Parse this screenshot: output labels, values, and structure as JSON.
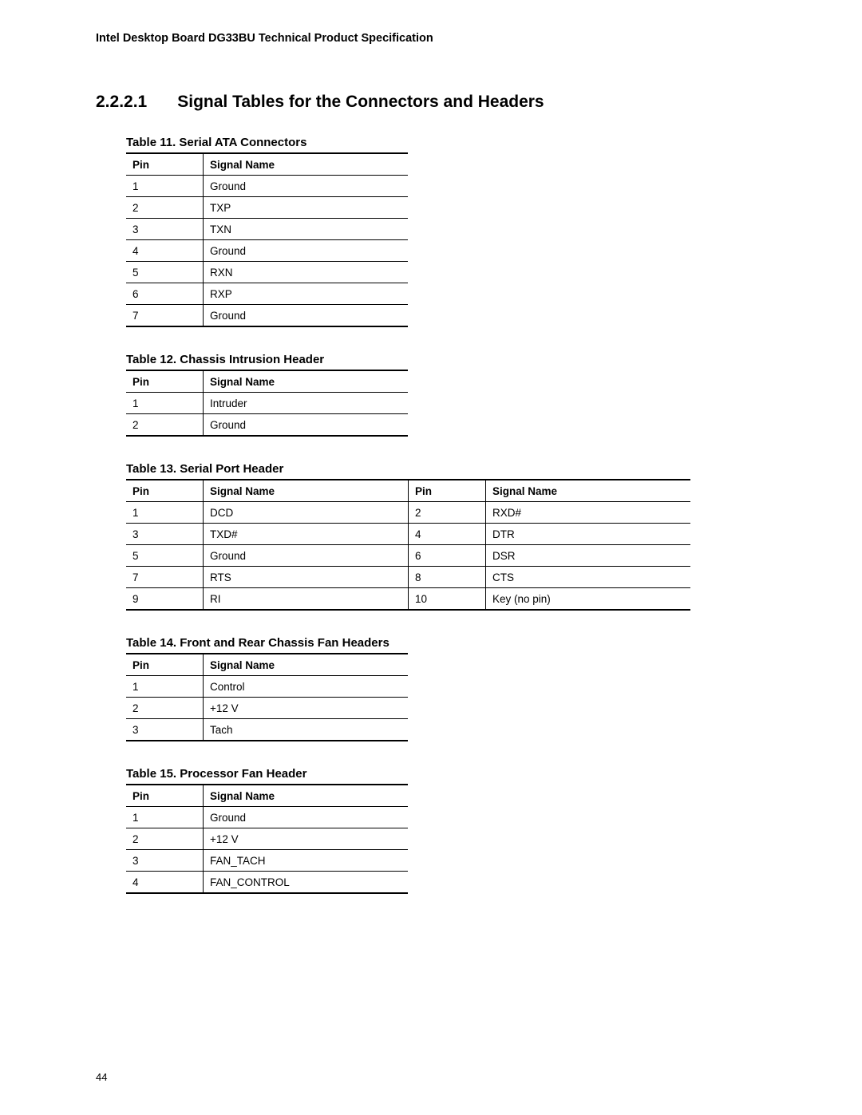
{
  "header": {
    "running_head": "Intel Desktop Board DG33BU Technical Product Specification"
  },
  "section": {
    "number": "2.2.2.1",
    "title": "Signal Tables for the Connectors and Headers"
  },
  "columns": {
    "pin": "Pin",
    "signal": "Signal Name"
  },
  "table11": {
    "title": "Table 11. Serial ATA Connectors",
    "rows": [
      {
        "pin": "1",
        "signal": "Ground"
      },
      {
        "pin": "2",
        "signal": "TXP"
      },
      {
        "pin": "3",
        "signal": "TXN"
      },
      {
        "pin": "4",
        "signal": "Ground"
      },
      {
        "pin": "5",
        "signal": "RXN"
      },
      {
        "pin": "6",
        "signal": "RXP"
      },
      {
        "pin": "7",
        "signal": "Ground"
      }
    ]
  },
  "table12": {
    "title": "Table 12. Chassis Intrusion Header",
    "rows": [
      {
        "pin": "1",
        "signal": "Intruder"
      },
      {
        "pin": "2",
        "signal": "Ground"
      }
    ]
  },
  "table13": {
    "title": "Table 13. Serial Port Header",
    "rows": [
      {
        "pinA": "1",
        "sigA": "DCD",
        "pinB": "2",
        "sigB": "RXD#"
      },
      {
        "pinA": "3",
        "sigA": "TXD#",
        "pinB": "4",
        "sigB": "DTR"
      },
      {
        "pinA": "5",
        "sigA": "Ground",
        "pinB": "6",
        "sigB": "DSR"
      },
      {
        "pinA": "7",
        "sigA": "RTS",
        "pinB": "8",
        "sigB": "CTS"
      },
      {
        "pinA": "9",
        "sigA": "RI",
        "pinB": "10",
        "sigB": "Key (no pin)"
      }
    ]
  },
  "table14": {
    "title": "Table 14. Front and Rear Chassis Fan Headers",
    "rows": [
      {
        "pin": "1",
        "signal": "Control"
      },
      {
        "pin": "2",
        "signal": "+12 V"
      },
      {
        "pin": "3",
        "signal": "Tach"
      }
    ]
  },
  "table15": {
    "title": "Table 15. Processor Fan Header",
    "rows": [
      {
        "pin": "1",
        "signal": "Ground"
      },
      {
        "pin": "2",
        "signal": "+12 V"
      },
      {
        "pin": "3",
        "signal": "FAN_TACH"
      },
      {
        "pin": "4",
        "signal": "FAN_CONTROL"
      }
    ]
  },
  "page_number": "44"
}
